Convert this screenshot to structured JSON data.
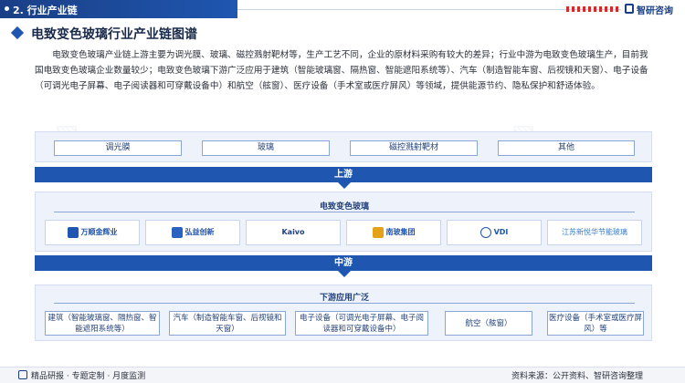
{
  "header": {
    "section": "2. 行业产业链",
    "logo_text": "智研咨询"
  },
  "title": "电致变色玻璃行业产业链图谱",
  "intro": "电致变色玻璃产业链上游主要为调光膜、玻璃、磁控溅射靶材等，生产工艺不同，企业的原材料采购有较大的差异；行业中游为电致变色玻璃生产，目前我国电致变色玻璃企业数量较少；电致变色玻璃下游广泛应用于建筑（智能玻璃窗、隔热窗、智能遮阳系统等）、汽车（制造智能车窗、后视镜和天窗）、电子设备（可调光电子屏幕、电子阅读器和可穿戴设备中）和航空（舷窗）、医疗设备（手术室或医疗屏风）等领域，提供能源节约、隐私保护和舒适体验。",
  "upstream": {
    "label": "上游",
    "items": [
      "调光膜",
      "玻璃",
      "磁控溅射靶材",
      "其他"
    ]
  },
  "midstream": {
    "label": "中游",
    "section_title": "电致变色玻璃",
    "companies": [
      "万顺金辉业",
      "弘益创新",
      "Kaivo",
      "南玻集团",
      "VDI",
      "江苏新悦华节能玻璃"
    ]
  },
  "downstream": {
    "section_title": "下游应用广泛",
    "items": [
      "建筑（智能玻璃窗、隔热窗、智能遮阳系统等）",
      "汽车（制造智能车窗、后视镜和天窗）",
      "电子设备（可调光电子屏幕、电子阅读器和可穿戴设备中）",
      "航空（舷窗）",
      "医疗设备（手术室或医疗屏风）等"
    ]
  },
  "footer": {
    "left": "精品研报 · 专题定制 · 月度监测",
    "right": "资料来源：公开资料、智研咨询整理"
  },
  "colors": {
    "primary": "#1f56b0",
    "dark": "#1a3f86",
    "panel": "#eef3fb"
  }
}
